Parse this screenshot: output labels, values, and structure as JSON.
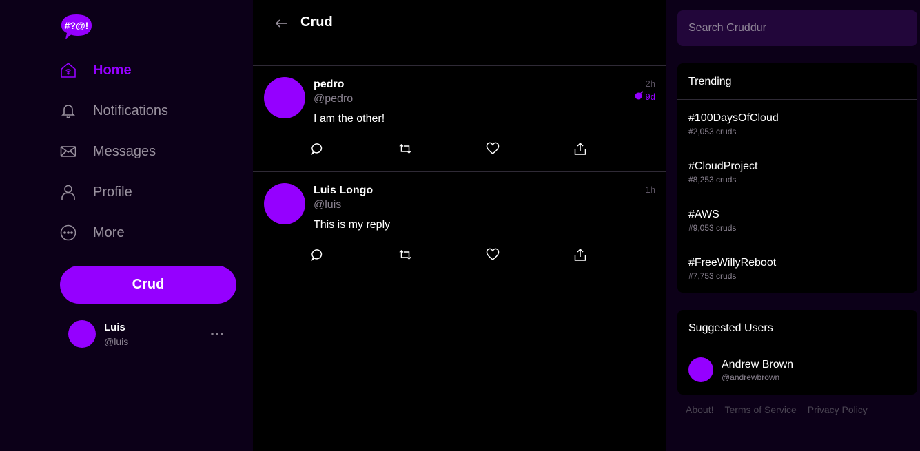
{
  "app": {
    "logo_text": "#?@!",
    "brand_color": "#9500ff"
  },
  "nav": {
    "items": [
      {
        "label": "Home",
        "icon": "home-icon",
        "active": true
      },
      {
        "label": "Notifications",
        "icon": "bell-icon",
        "active": false
      },
      {
        "label": "Messages",
        "icon": "envelope-icon",
        "active": false
      },
      {
        "label": "Profile",
        "icon": "user-icon",
        "active": false
      },
      {
        "label": "More",
        "icon": "more-circle-icon",
        "active": false
      }
    ],
    "crud_button_label": "Crud"
  },
  "current_user": {
    "display_name": "Luis",
    "handle": "@luis"
  },
  "main": {
    "title": "Crud",
    "posts": [
      {
        "display_name": "pedro",
        "handle": "@pedro",
        "message": "I am the other!",
        "time_ago": "2h",
        "expires_in": "9d"
      },
      {
        "display_name": "Luis Longo",
        "handle": "@luis",
        "message": "This is my reply",
        "time_ago": "1h"
      }
    ]
  },
  "search": {
    "placeholder": "Search Cruddur"
  },
  "trending": {
    "title": "Trending",
    "items": [
      {
        "name": "#100DaysOfCloud",
        "count": "#2,053 cruds"
      },
      {
        "name": "#CloudProject",
        "count": "#8,253 cruds"
      },
      {
        "name": "#AWS",
        "count": "#9,053 cruds"
      },
      {
        "name": "#FreeWillyReboot",
        "count": "#7,753 cruds"
      }
    ]
  },
  "suggested": {
    "title": "Suggested Users",
    "users": [
      {
        "display_name": "Andrew Brown",
        "handle": "@andrewbrown"
      }
    ]
  },
  "footer": {
    "links": [
      "About!",
      "Terms of Service",
      "Privacy Policy"
    ]
  }
}
